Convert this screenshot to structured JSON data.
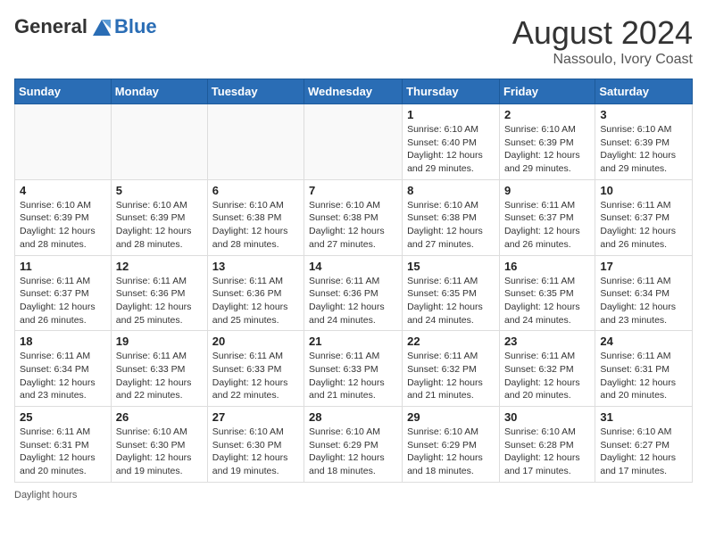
{
  "header": {
    "logo_general": "General",
    "logo_blue": "Blue",
    "month_title": "August 2024",
    "location": "Nassoulo, Ivory Coast"
  },
  "days_of_week": [
    "Sunday",
    "Monday",
    "Tuesday",
    "Wednesday",
    "Thursday",
    "Friday",
    "Saturday"
  ],
  "weeks": [
    [
      {
        "day": "",
        "info": ""
      },
      {
        "day": "",
        "info": ""
      },
      {
        "day": "",
        "info": ""
      },
      {
        "day": "",
        "info": ""
      },
      {
        "day": "1",
        "info": "Sunrise: 6:10 AM\nSunset: 6:40 PM\nDaylight: 12 hours\nand 29 minutes."
      },
      {
        "day": "2",
        "info": "Sunrise: 6:10 AM\nSunset: 6:39 PM\nDaylight: 12 hours\nand 29 minutes."
      },
      {
        "day": "3",
        "info": "Sunrise: 6:10 AM\nSunset: 6:39 PM\nDaylight: 12 hours\nand 29 minutes."
      }
    ],
    [
      {
        "day": "4",
        "info": "Sunrise: 6:10 AM\nSunset: 6:39 PM\nDaylight: 12 hours\nand 28 minutes."
      },
      {
        "day": "5",
        "info": "Sunrise: 6:10 AM\nSunset: 6:39 PM\nDaylight: 12 hours\nand 28 minutes."
      },
      {
        "day": "6",
        "info": "Sunrise: 6:10 AM\nSunset: 6:38 PM\nDaylight: 12 hours\nand 28 minutes."
      },
      {
        "day": "7",
        "info": "Sunrise: 6:10 AM\nSunset: 6:38 PM\nDaylight: 12 hours\nand 27 minutes."
      },
      {
        "day": "8",
        "info": "Sunrise: 6:10 AM\nSunset: 6:38 PM\nDaylight: 12 hours\nand 27 minutes."
      },
      {
        "day": "9",
        "info": "Sunrise: 6:11 AM\nSunset: 6:37 PM\nDaylight: 12 hours\nand 26 minutes."
      },
      {
        "day": "10",
        "info": "Sunrise: 6:11 AM\nSunset: 6:37 PM\nDaylight: 12 hours\nand 26 minutes."
      }
    ],
    [
      {
        "day": "11",
        "info": "Sunrise: 6:11 AM\nSunset: 6:37 PM\nDaylight: 12 hours\nand 26 minutes."
      },
      {
        "day": "12",
        "info": "Sunrise: 6:11 AM\nSunset: 6:36 PM\nDaylight: 12 hours\nand 25 minutes."
      },
      {
        "day": "13",
        "info": "Sunrise: 6:11 AM\nSunset: 6:36 PM\nDaylight: 12 hours\nand 25 minutes."
      },
      {
        "day": "14",
        "info": "Sunrise: 6:11 AM\nSunset: 6:36 PM\nDaylight: 12 hours\nand 24 minutes."
      },
      {
        "day": "15",
        "info": "Sunrise: 6:11 AM\nSunset: 6:35 PM\nDaylight: 12 hours\nand 24 minutes."
      },
      {
        "day": "16",
        "info": "Sunrise: 6:11 AM\nSunset: 6:35 PM\nDaylight: 12 hours\nand 24 minutes."
      },
      {
        "day": "17",
        "info": "Sunrise: 6:11 AM\nSunset: 6:34 PM\nDaylight: 12 hours\nand 23 minutes."
      }
    ],
    [
      {
        "day": "18",
        "info": "Sunrise: 6:11 AM\nSunset: 6:34 PM\nDaylight: 12 hours\nand 23 minutes."
      },
      {
        "day": "19",
        "info": "Sunrise: 6:11 AM\nSunset: 6:33 PM\nDaylight: 12 hours\nand 22 minutes."
      },
      {
        "day": "20",
        "info": "Sunrise: 6:11 AM\nSunset: 6:33 PM\nDaylight: 12 hours\nand 22 minutes."
      },
      {
        "day": "21",
        "info": "Sunrise: 6:11 AM\nSunset: 6:33 PM\nDaylight: 12 hours\nand 21 minutes."
      },
      {
        "day": "22",
        "info": "Sunrise: 6:11 AM\nSunset: 6:32 PM\nDaylight: 12 hours\nand 21 minutes."
      },
      {
        "day": "23",
        "info": "Sunrise: 6:11 AM\nSunset: 6:32 PM\nDaylight: 12 hours\nand 20 minutes."
      },
      {
        "day": "24",
        "info": "Sunrise: 6:11 AM\nSunset: 6:31 PM\nDaylight: 12 hours\nand 20 minutes."
      }
    ],
    [
      {
        "day": "25",
        "info": "Sunrise: 6:11 AM\nSunset: 6:31 PM\nDaylight: 12 hours\nand 20 minutes."
      },
      {
        "day": "26",
        "info": "Sunrise: 6:10 AM\nSunset: 6:30 PM\nDaylight: 12 hours\nand 19 minutes."
      },
      {
        "day": "27",
        "info": "Sunrise: 6:10 AM\nSunset: 6:30 PM\nDaylight: 12 hours\nand 19 minutes."
      },
      {
        "day": "28",
        "info": "Sunrise: 6:10 AM\nSunset: 6:29 PM\nDaylight: 12 hours\nand 18 minutes."
      },
      {
        "day": "29",
        "info": "Sunrise: 6:10 AM\nSunset: 6:29 PM\nDaylight: 12 hours\nand 18 minutes."
      },
      {
        "day": "30",
        "info": "Sunrise: 6:10 AM\nSunset: 6:28 PM\nDaylight: 12 hours\nand 17 minutes."
      },
      {
        "day": "31",
        "info": "Sunrise: 6:10 AM\nSunset: 6:27 PM\nDaylight: 12 hours\nand 17 minutes."
      }
    ]
  ],
  "footer": {
    "daylight_hours": "Daylight hours"
  }
}
